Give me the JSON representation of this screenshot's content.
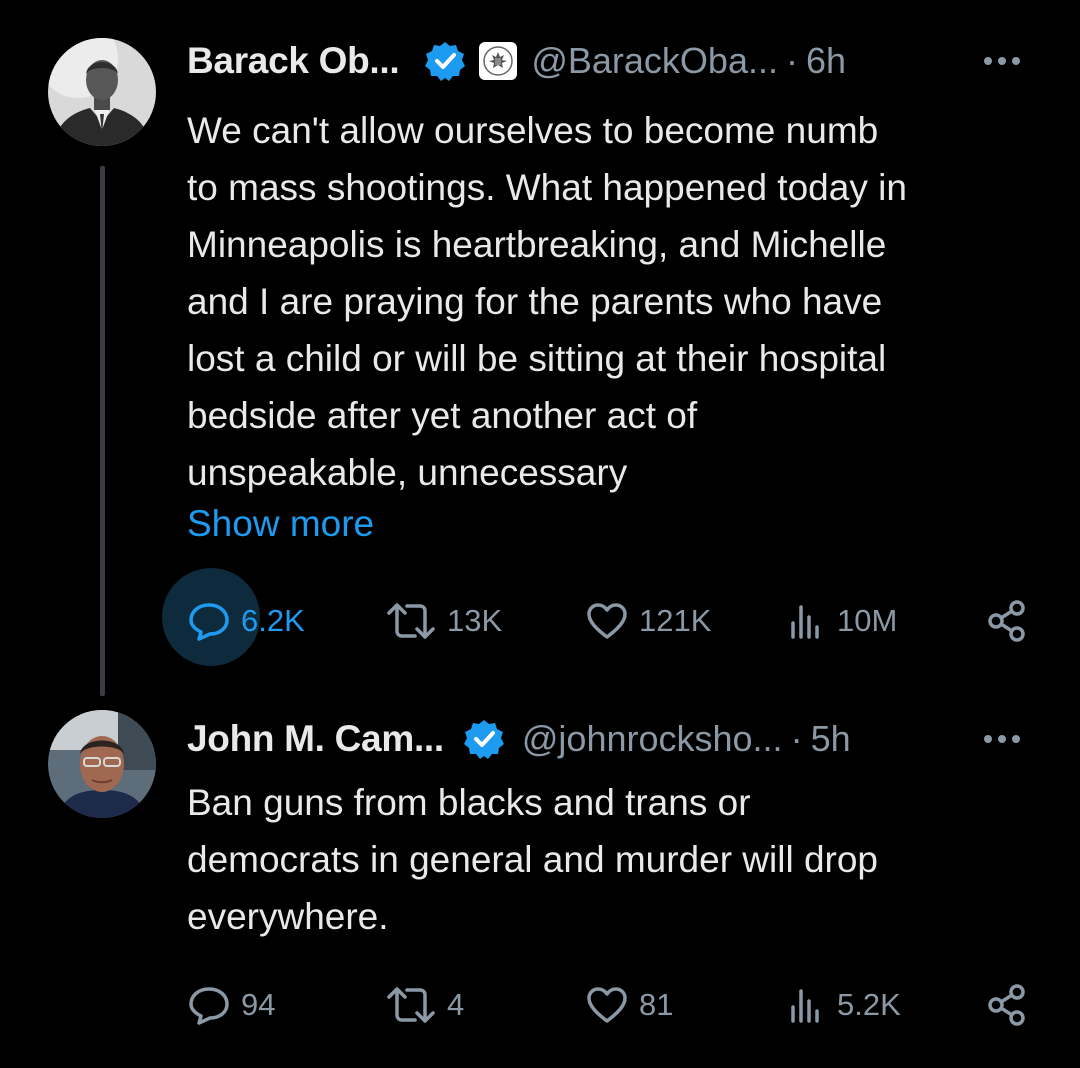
{
  "tweets": [
    {
      "author_name": "Barack Ob...",
      "handle": "@BarackOba...",
      "separator": "·",
      "time": "6h",
      "lines": [
        "We can't allow ourselves to become numb",
        "to mass shootings. What happened today in",
        "Minneapolis is heartbreaking, and Michelle",
        "and I are praying for the parents who have",
        "lost a child or will be sitting at their hospital",
        "bedside after yet another act of",
        "unspeakable, unnecessary"
      ],
      "show_more": "Show more",
      "stats": {
        "replies": "6.2K",
        "reposts": "13K",
        "likes": "121K",
        "views": "10M"
      },
      "icons": [
        "avatar",
        "verified-badge-icon",
        "government-seal-icon",
        "more-icon",
        "reply-icon",
        "repost-icon",
        "like-icon",
        "views-icon",
        "share-icon"
      ]
    },
    {
      "author_name": "John M. Cam...",
      "handle": "@johnrocksho...",
      "separator": "·",
      "time": "5h",
      "lines": [
        "Ban guns from blacks and trans or",
        "democrats in general and murder will drop",
        "everywhere."
      ],
      "stats": {
        "replies": "94",
        "reposts": "4",
        "likes": "81",
        "views": "5.2K"
      },
      "icons": [
        "avatar",
        "verified-badge-icon",
        "more-icon",
        "reply-icon",
        "repost-icon",
        "like-icon",
        "views-icon",
        "share-icon"
      ]
    }
  ],
  "colors": {
    "background": "#000000",
    "text": "#e7e9ea",
    "muted": "#8b98a5",
    "accent": "#1d9bf0"
  }
}
